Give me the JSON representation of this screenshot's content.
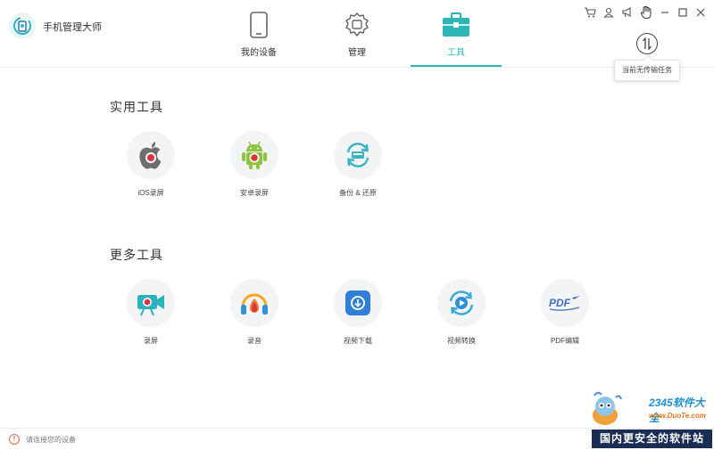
{
  "app": {
    "title": "手机管理大师"
  },
  "nav": {
    "tabs": [
      {
        "label": "我的设备",
        "icon": "phone-icon"
      },
      {
        "label": "管理",
        "icon": "gear-icon"
      },
      {
        "label": "工具",
        "icon": "toolbox-icon",
        "active": true
      }
    ]
  },
  "window_controls": [
    "cart-icon",
    "user-icon",
    "megaphone-icon",
    "hand-icon",
    "minimize-icon",
    "maximize-icon",
    "close-icon"
  ],
  "transfer": {
    "icon": "transfer-arrows-icon",
    "tooltip": "当前无传输任务"
  },
  "sections": {
    "practical": {
      "title": "实用工具",
      "tools": [
        {
          "label": "iOS录屏",
          "icon": "apple-record-icon"
        },
        {
          "label": "安卓录屏",
          "icon": "android-record-icon"
        },
        {
          "label": "备份 & 还原",
          "icon": "backup-restore-icon"
        }
      ]
    },
    "more": {
      "title": "更多工具",
      "tools": [
        {
          "label": "录屏",
          "icon": "screen-record-icon"
        },
        {
          "label": "录音",
          "icon": "audio-record-icon"
        },
        {
          "label": "视频下载",
          "icon": "video-download-icon"
        },
        {
          "label": "视频转换",
          "icon": "video-convert-icon"
        },
        {
          "label": "PDF编辑",
          "icon": "pdf-edit-icon"
        }
      ]
    }
  },
  "status": {
    "text": "请连接您的设备",
    "icon": "info-icon"
  },
  "watermark": {
    "brand": "2345软件大全",
    "url": "www.DuoTe.com",
    "banner": "国内更安全的软件站"
  },
  "colors": {
    "accent": "#2cb6b6",
    "status_warning": "#e06a4a",
    "banner_bg": "#1a2d54"
  }
}
